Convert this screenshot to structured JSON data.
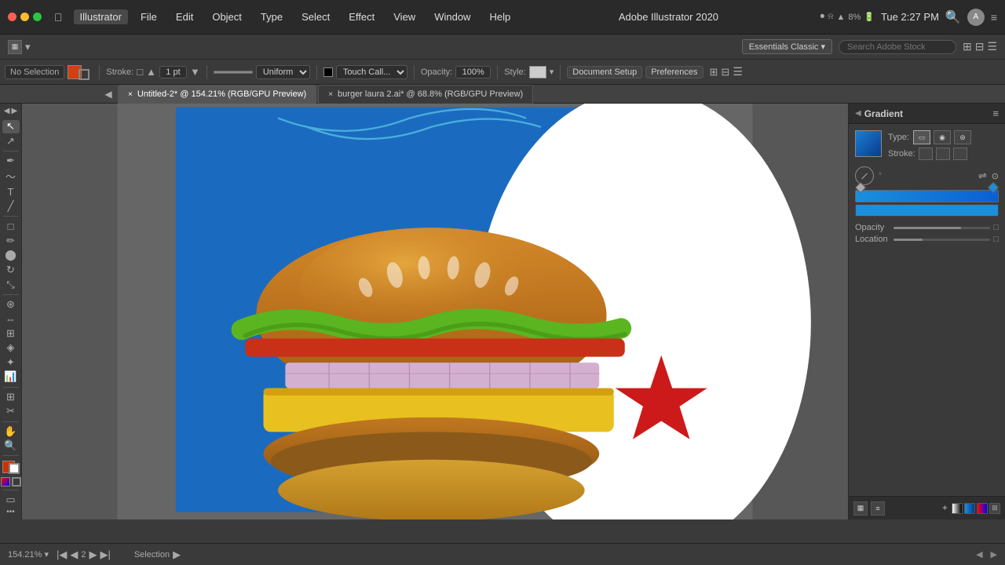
{
  "titlebar": {
    "app_name": "Illustrator",
    "menus": [
      "File",
      "Edit",
      "Object",
      "Type",
      "Select",
      "Effect",
      "View",
      "Window",
      "Help"
    ],
    "center_title": "Adobe Illustrator 2020",
    "battery": "8%",
    "time": "Tue 2:27 PM",
    "essentials_label": "Essentials Classic",
    "search_placeholder": "Search Adobe Stock"
  },
  "toolbar1": {
    "selection_label": "No Selection",
    "stroke_label": "Stroke:",
    "stroke_value": "1 pt",
    "stroke_option": "Uniform",
    "touch_label": "Touch Call...",
    "opacity_label": "Opacity:",
    "opacity_value": "100%",
    "style_label": "Style:",
    "doc_setup_btn": "Document Setup",
    "preferences_btn": "Preferences"
  },
  "tabs": [
    {
      "label": "Untitled-2* @ 154.21% (RGB/GPU Preview)",
      "active": true
    },
    {
      "label": "burger laura 2.ai* @ 68.8% (RGB/GPU Preview)",
      "active": false
    }
  ],
  "gradient_panel": {
    "title": "Gradient",
    "type_label": "Type:",
    "stroke_label": "Stroke:",
    "opacity_label": "Opacity",
    "location_label": "Location"
  },
  "status_bar": {
    "zoom": "154.21%",
    "page": "2",
    "tool": "Selection"
  },
  "tools": [
    "▲",
    "↖",
    "≡",
    "⊹",
    "✎",
    "⊘",
    "T",
    "∅",
    "◇",
    "⊡",
    "⟲",
    "⇔",
    "⊞",
    "✦",
    "✂",
    "⊕",
    "✋",
    "🔍"
  ]
}
